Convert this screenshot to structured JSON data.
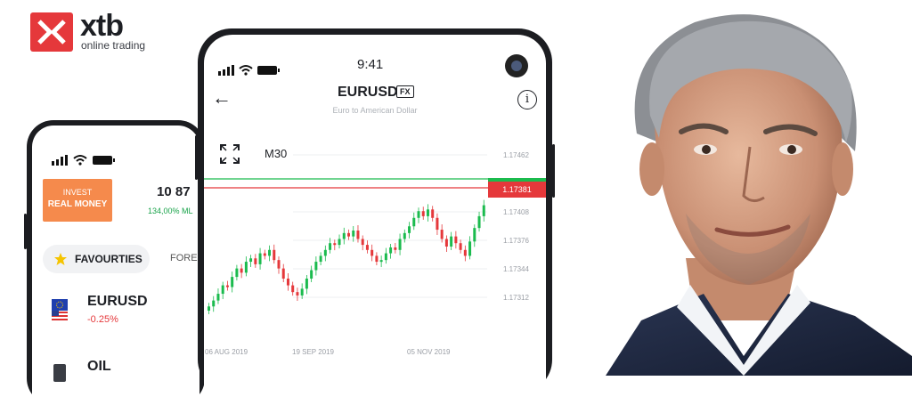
{
  "logo": {
    "word": "xtb",
    "tagline": "online trading"
  },
  "back_phone": {
    "invest_button": {
      "line1": "INVEST",
      "line2": "REAL MONEY"
    },
    "balance": "10 87",
    "balance_pl": "134,00% ML",
    "tabs": {
      "favourites": "FAVOURTIES",
      "forex": "FOREX"
    },
    "symbols": [
      {
        "name": "EURUSD",
        "change": "-0.25%"
      },
      {
        "name": "OIL"
      }
    ]
  },
  "front_phone": {
    "status": {
      "time": "9:41"
    },
    "header": {
      "symbol": "EURUSD",
      "badge": "FX",
      "description": "Euro to American Dollar",
      "info_label": "i"
    },
    "chart_toolbar": {
      "interval": "M30"
    },
    "current_price": "1.17381",
    "colors": {
      "up": "#1bbb4e",
      "down": "#e5383b"
    }
  },
  "chart_data": {
    "type": "candlestick",
    "y_ticks": [
      "1.17462",
      "1.17408",
      "1.17376",
      "1.17344",
      "1.17312"
    ],
    "x_ticks": [
      "06 AUG 2019",
      "19 SEP 2019",
      "05 NOV 2019"
    ],
    "ylim": [
      1.173,
      1.1749
    ],
    "current_price": 1.17381,
    "candles": [
      1.17305,
      1.17312,
      1.1732,
      1.1733,
      1.17328,
      1.1734,
      1.1735,
      1.17345,
      1.17358,
      1.17362,
      1.17355,
      1.17368,
      1.17365,
      1.17372,
      1.1736,
      1.1735,
      1.17338,
      1.1733,
      1.17322,
      1.17318,
      1.17326,
      1.17338,
      1.17348,
      1.17358,
      1.17365,
      1.17372,
      1.1738,
      1.17378,
      1.17385,
      1.17392,
      1.17388,
      1.17395,
      1.17385,
      1.17378,
      1.17372,
      1.17365,
      1.17358,
      1.1736,
      1.17368,
      1.17375,
      1.17372,
      1.17385,
      1.17392,
      1.174,
      1.1741,
      1.17418,
      1.17412,
      1.1742,
      1.1741,
      1.17396,
      1.17385,
      1.17376,
      1.17388,
      1.1738,
      1.17372,
      1.17365,
      1.17382,
      1.17398,
      1.17412,
      1.17425
    ]
  },
  "icons": [
    "xtb-logo-icon",
    "signal-icon",
    "wifi-icon",
    "battery-icon",
    "back-arrow-icon",
    "info-icon",
    "expand-icon",
    "star-icon",
    "us-eu-flag-icon",
    "oil-barrel-icon",
    "camera-icon"
  ]
}
